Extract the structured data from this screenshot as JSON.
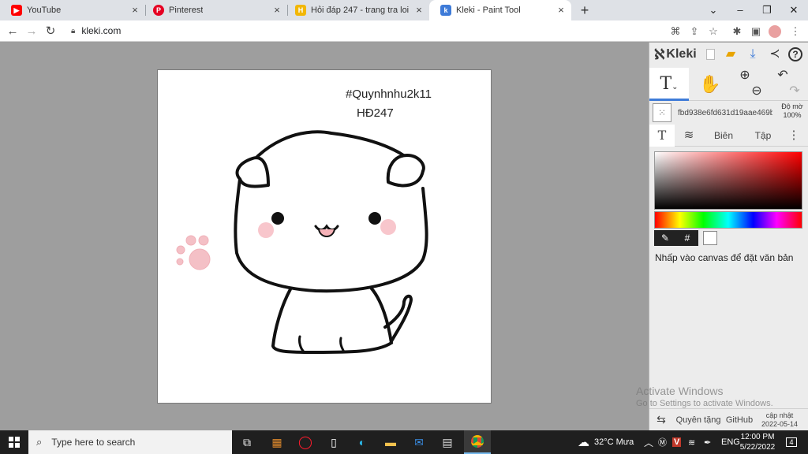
{
  "browser": {
    "tabs": [
      {
        "title": "YouTube",
        "icon": "youtube-icon",
        "color": "#ff0000"
      },
      {
        "title": "Pinterest",
        "icon": "pinterest-icon",
        "color": "#e60023"
      },
      {
        "title": "Hỏi đáp 247 - trang tra loi",
        "icon": "hoidap247-icon",
        "color": "#f2b705"
      },
      {
        "title": "Kleki - Paint Tool",
        "icon": "kleki-icon",
        "color": "#3e7bd8"
      }
    ],
    "url": "kleki.com"
  },
  "canvas": {
    "caption_line1": "#Quynhnhu2k11",
    "caption_line2": "HĐ247"
  },
  "kleki": {
    "brand": "Kleki",
    "layer_name": "fbd938e6fd631d19aae469b",
    "opacity_label": "Độ mờ",
    "opacity_value": "100%",
    "tab_edit": "Biên",
    "tab_file": "Tập",
    "hint": "Nhấp vào canvas để đặt văn bản",
    "footer_help": "Quyên tặng",
    "footer_github": "GitHub",
    "footer_update_label": "cập nhật",
    "footer_update_date": "2022-05-14",
    "accent": "#3e7bd8"
  },
  "watermark": {
    "line1": "Activate Windows",
    "line2": "Go to Settings to activate Windows."
  },
  "taskbar": {
    "search_placeholder": "Type here to search",
    "weather": "32°C  Mưa",
    "language": "ENG",
    "time": "12:00 PM",
    "date": "5/22/2022",
    "notification_count": "4"
  }
}
